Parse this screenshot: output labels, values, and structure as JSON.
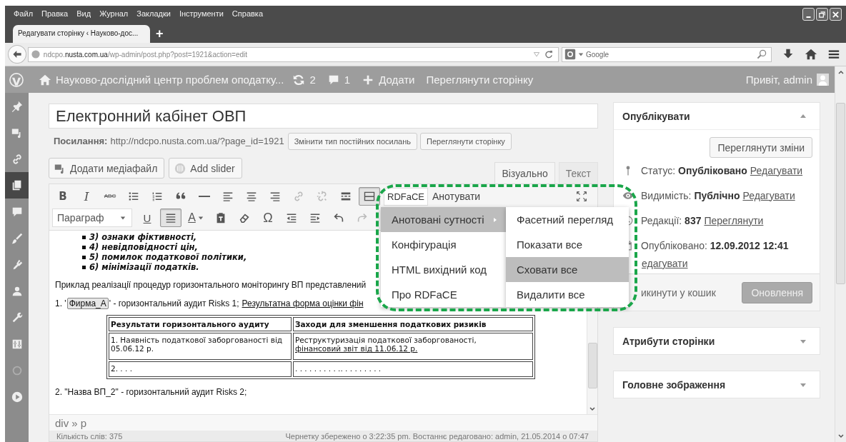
{
  "browser": {
    "menu": [
      "Файл",
      "Правка",
      "Вид",
      "Журнал",
      "Закладки",
      "Інструменти",
      "Справка"
    ],
    "tab": {
      "title": "Редагувати сторінку ‹ Науково-дос..."
    },
    "new_tab": "+",
    "url": "ndcpo.**nusta.com.ua**/wp-admin/post.php?post=1921&action=edit",
    "search": {
      "placeholder": "Google"
    }
  },
  "admin_bar": {
    "site": "Науково-дослідний центр проблем оподатку...",
    "updates": "2",
    "comments": "1",
    "new": "Додати",
    "view": "Переглянути сторінку",
    "greeting": "Привіт, admin"
  },
  "admin_menu": [
    {
      "kind": "posts",
      "selected": false
    },
    {
      "kind": "media",
      "selected": false
    },
    {
      "kind": "links",
      "selected": false
    },
    {
      "kind": "pages",
      "selected": true
    },
    {
      "kind": "comments",
      "selected": false
    },
    {
      "kind": "appearance",
      "selected": false
    },
    {
      "kind": "plugins",
      "selected": false
    },
    {
      "kind": "users",
      "selected": false
    },
    {
      "kind": "tools",
      "selected": false
    },
    {
      "kind": "settings",
      "selected": false
    },
    {
      "kind": "faded",
      "selected": false
    },
    {
      "kind": "play",
      "selected": false
    }
  ],
  "post": {
    "title": "Електронний кабінет ОВП",
    "permalink_label": "Посилання:",
    "permalink": "http://ndcpo.nusta.com.ua/?page_id=1921",
    "permalink_buttons": [
      "Змінити тип постійних посилань",
      "Переглянути сторінку"
    ],
    "media_buttons": [
      {
        "kind": "media",
        "label": "Додати медіафайл"
      },
      {
        "kind": "slider",
        "label": "Add slider"
      }
    ],
    "editor_tabs": [
      {
        "label": "Візуально",
        "selected": true
      },
      {
        "label": "Текст",
        "selected": false
      }
    ],
    "toolbar1": [
      {
        "kind": "bold",
        "label": "B",
        "active": false,
        "disabled": false
      },
      {
        "kind": "italic",
        "label": "I",
        "active": false,
        "disabled": false
      },
      {
        "kind": "strike",
        "label": "ABC",
        "active": false,
        "disabled": false
      },
      {
        "kind": "ul",
        "active": false,
        "disabled": false
      },
      {
        "kind": "ol",
        "active": false,
        "disabled": false
      },
      {
        "kind": "quote",
        "active": false,
        "disabled": false
      },
      {
        "kind": "hr",
        "active": false,
        "disabled": false
      },
      {
        "kind": "alignleft",
        "active": false,
        "disabled": false
      },
      {
        "kind": "aligncenter",
        "active": false,
        "disabled": false
      },
      {
        "kind": "alignright",
        "active": false,
        "disabled": false
      },
      {
        "kind": "link",
        "active": false,
        "disabled": true
      },
      {
        "kind": "unlink",
        "active": false,
        "disabled": true
      },
      {
        "kind": "more",
        "active": false,
        "disabled": false
      },
      {
        "kind": "kitchen",
        "active": true,
        "disabled": false
      }
    ],
    "rdface": {
      "button": "RDFaCE",
      "annotate": "Анотувати"
    },
    "format": "Параграф",
    "toolbar2": [
      {
        "kind": "underline",
        "label": "U",
        "active": false,
        "disabled": false
      },
      {
        "kind": "justify",
        "active": true,
        "disabled": false
      },
      {
        "kind": "textcolor",
        "label": "A",
        "active": false,
        "disabled": false
      },
      {
        "kind": "paste",
        "active": false,
        "disabled": false
      },
      {
        "kind": "eraser",
        "active": false,
        "disabled": false
      },
      {
        "kind": "charmap",
        "label": "Ω",
        "active": false,
        "disabled": false
      },
      {
        "kind": "outdent",
        "active": false,
        "disabled": false
      },
      {
        "kind": "indent",
        "active": false,
        "disabled": false
      },
      {
        "kind": "undo",
        "active": false,
        "disabled": false
      },
      {
        "kind": "redo",
        "active": false,
        "disabled": true
      }
    ],
    "content": {
      "list": [
        "3) ознаки фіктивності,",
        "4) невідповідності цін,",
        "5) помилок податкової політики,",
        "6) мінімізації податків."
      ],
      "intro": "Приклад реалізації процедур горизонтального моніторингу ВП представлений",
      "item1": {
        "before": "1. '",
        "entity": "Фирма_А",
        "after": "' - горизонтальний аудит Risks 1;",
        "link": "Результатна форма оцінки фін"
      },
      "table": {
        "header": [
          "Результати горизонтального аудиту",
          "Заходи для зменшення податкових ризиків"
        ],
        "rows": [
          [
            {
              "text": "1. Наявність податкової заборгованості від 05.06.12 р."
            },
            {
              "text": "Реструктуризація податкової заборгованості,",
              "link": "фінансовий звіт від 11.06.12 р."
            }
          ],
          [
            {
              "text": "2. . . ."
            },
            {
              "text": ". . . . . . . . . .. . . . . . . . ."
            }
          ]
        ]
      },
      "item2": "2. \"Назва ВП_2\" - горизонтальний аудит Risks 2;"
    },
    "path": "div » p",
    "status": {
      "words": "Кількість слів: 375",
      "saved": "Чернетку збережено о 3:22:35 pm. Востаннє редаговано: admin, 21.05.2014 о 07:47"
    }
  },
  "rdface_menu": [
    {
      "label": "Анотовані сутності",
      "selected": true,
      "submenu": true
    },
    {
      "label": "Конфігурація",
      "selected": false,
      "submenu": false
    },
    {
      "label": "HTML вихідний код",
      "selected": false,
      "submenu": false
    },
    {
      "label": "Про RDFaCE",
      "selected": false,
      "submenu": false
    }
  ],
  "rdface_submenu": [
    {
      "label": "Фасетний перегляд",
      "selected": false
    },
    {
      "label": "Показати все",
      "selected": false
    },
    {
      "label": "Сховати все",
      "selected": true
    },
    {
      "label": "Видалити все",
      "selected": false
    }
  ],
  "publish": {
    "title": "Опублікувати",
    "expanded": true,
    "preview": "Переглянути зміни",
    "rows": [
      {
        "kind": "status",
        "label": "Статус:",
        "value": "Опубліковано",
        "link": "Редагувати"
      },
      {
        "kind": "visibility",
        "label": "Видимість:",
        "value": "Публічно",
        "link": "Редагувати"
      },
      {
        "kind": "revisions",
        "label": "Редакції:",
        "value": "837",
        "link": "Переглянути"
      },
      {
        "kind": "date",
        "label": "Опубліковано:",
        "value": "12.09.2012 12:41",
        "link": "едагувати"
      }
    ],
    "trash": "икинути у кошик",
    "update": "Оновлення"
  },
  "boxes": [
    {
      "title": "Атрибути сторінки",
      "expanded": false
    },
    {
      "title": "Головне зображення",
      "expanded": false
    }
  ]
}
